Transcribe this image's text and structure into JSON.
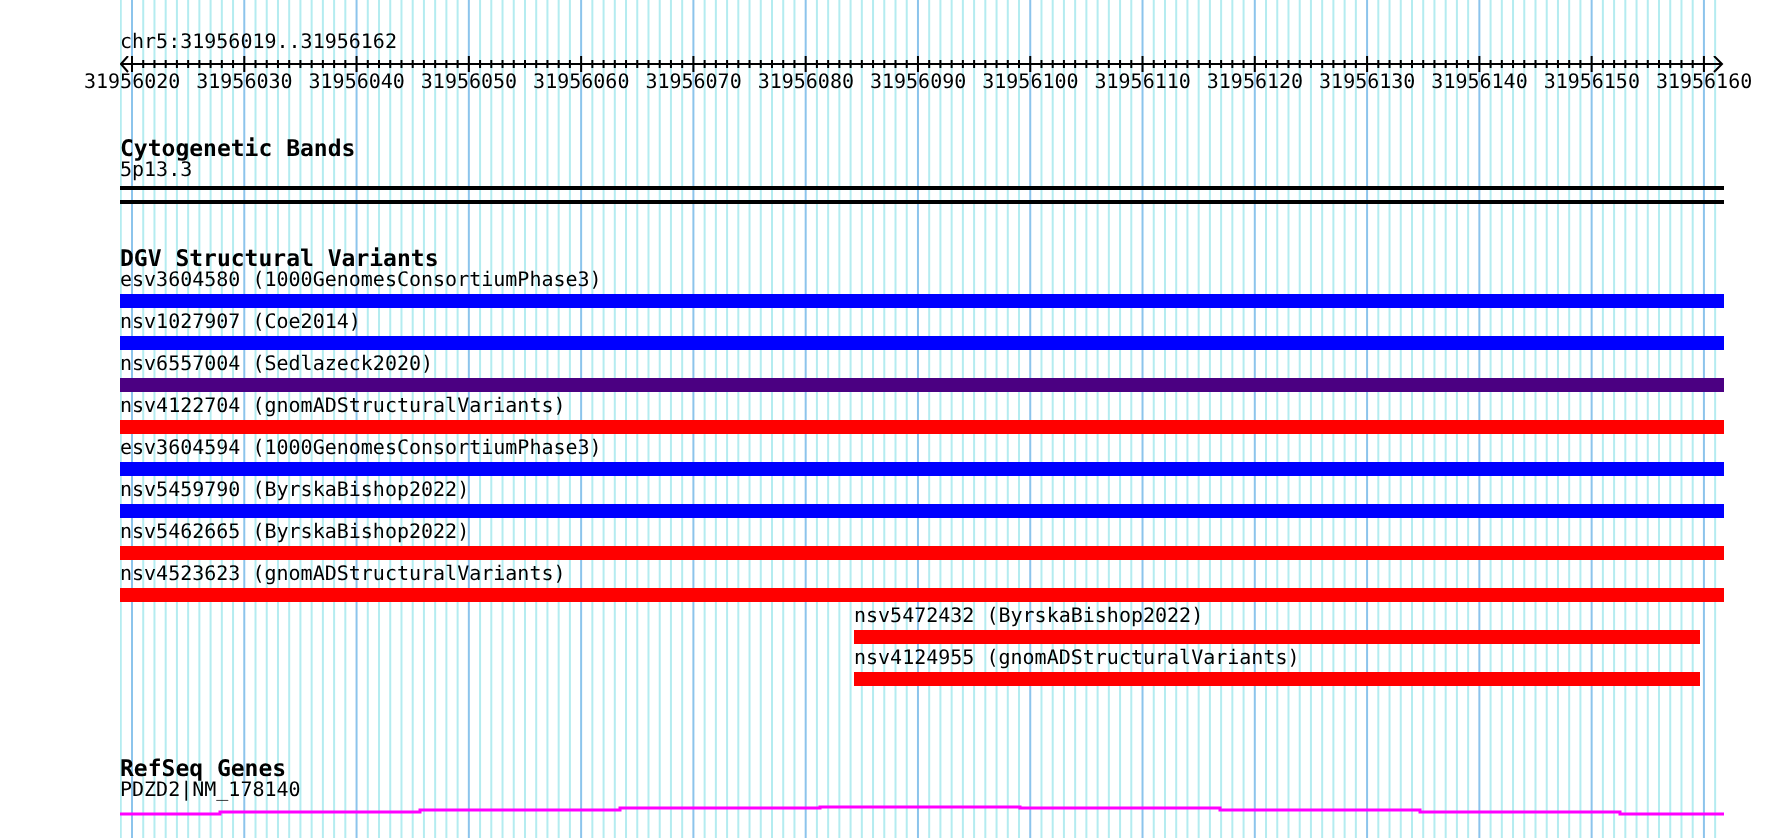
{
  "location": "chr5:31956019..31956162",
  "ruler_labels": [
    "31956020",
    "31956030",
    "31956040",
    "31956050",
    "31956060",
    "31956070",
    "31956080",
    "31956090",
    "31956100",
    "31956110",
    "31956120",
    "31956130",
    "31956140",
    "31956150",
    "31956160"
  ],
  "cytogenetic_bands": {
    "title": "Cytogenetic Bands",
    "label": "5p13.3"
  },
  "dgv": {
    "title": "DGV Structural Variants",
    "variants": [
      {
        "label": "esv3604580 (1000GenomesConsortiumPhase3)",
        "color": "#0000ff",
        "kind": "full"
      },
      {
        "label": "nsv1027907 (Coe2014)",
        "color": "#0000ff",
        "kind": "full"
      },
      {
        "label": "nsv6557004 (Sedlazeck2020)",
        "color": "#4b0082",
        "kind": "full"
      },
      {
        "label": "nsv4122704 (gnomADStructuralVariants)",
        "color": "#ff0000",
        "kind": "full"
      },
      {
        "label": "esv3604594 (1000GenomesConsortiumPhase3)",
        "color": "#0000ff",
        "kind": "full"
      },
      {
        "label": "nsv5459790 (ByrskaBishop2022)",
        "color": "#0000ff",
        "kind": "full"
      },
      {
        "label": "nsv5462665 (ByrskaBishop2022)",
        "color": "#ff0000",
        "kind": "full"
      },
      {
        "label": "nsv4523623 (gnomADStructuralVariants)",
        "color": "#ff0000",
        "kind": "full"
      },
      {
        "label": "nsv5472432 (ByrskaBishop2022)",
        "color": "#ff0000",
        "kind": "partial"
      },
      {
        "label": "nsv4124955 (gnomADStructuralVariants)",
        "color": "#ff0000",
        "kind": "partial"
      }
    ]
  },
  "refseq": {
    "title": "RefSeq Genes",
    "label": "PDZD2|NM_178140"
  }
}
